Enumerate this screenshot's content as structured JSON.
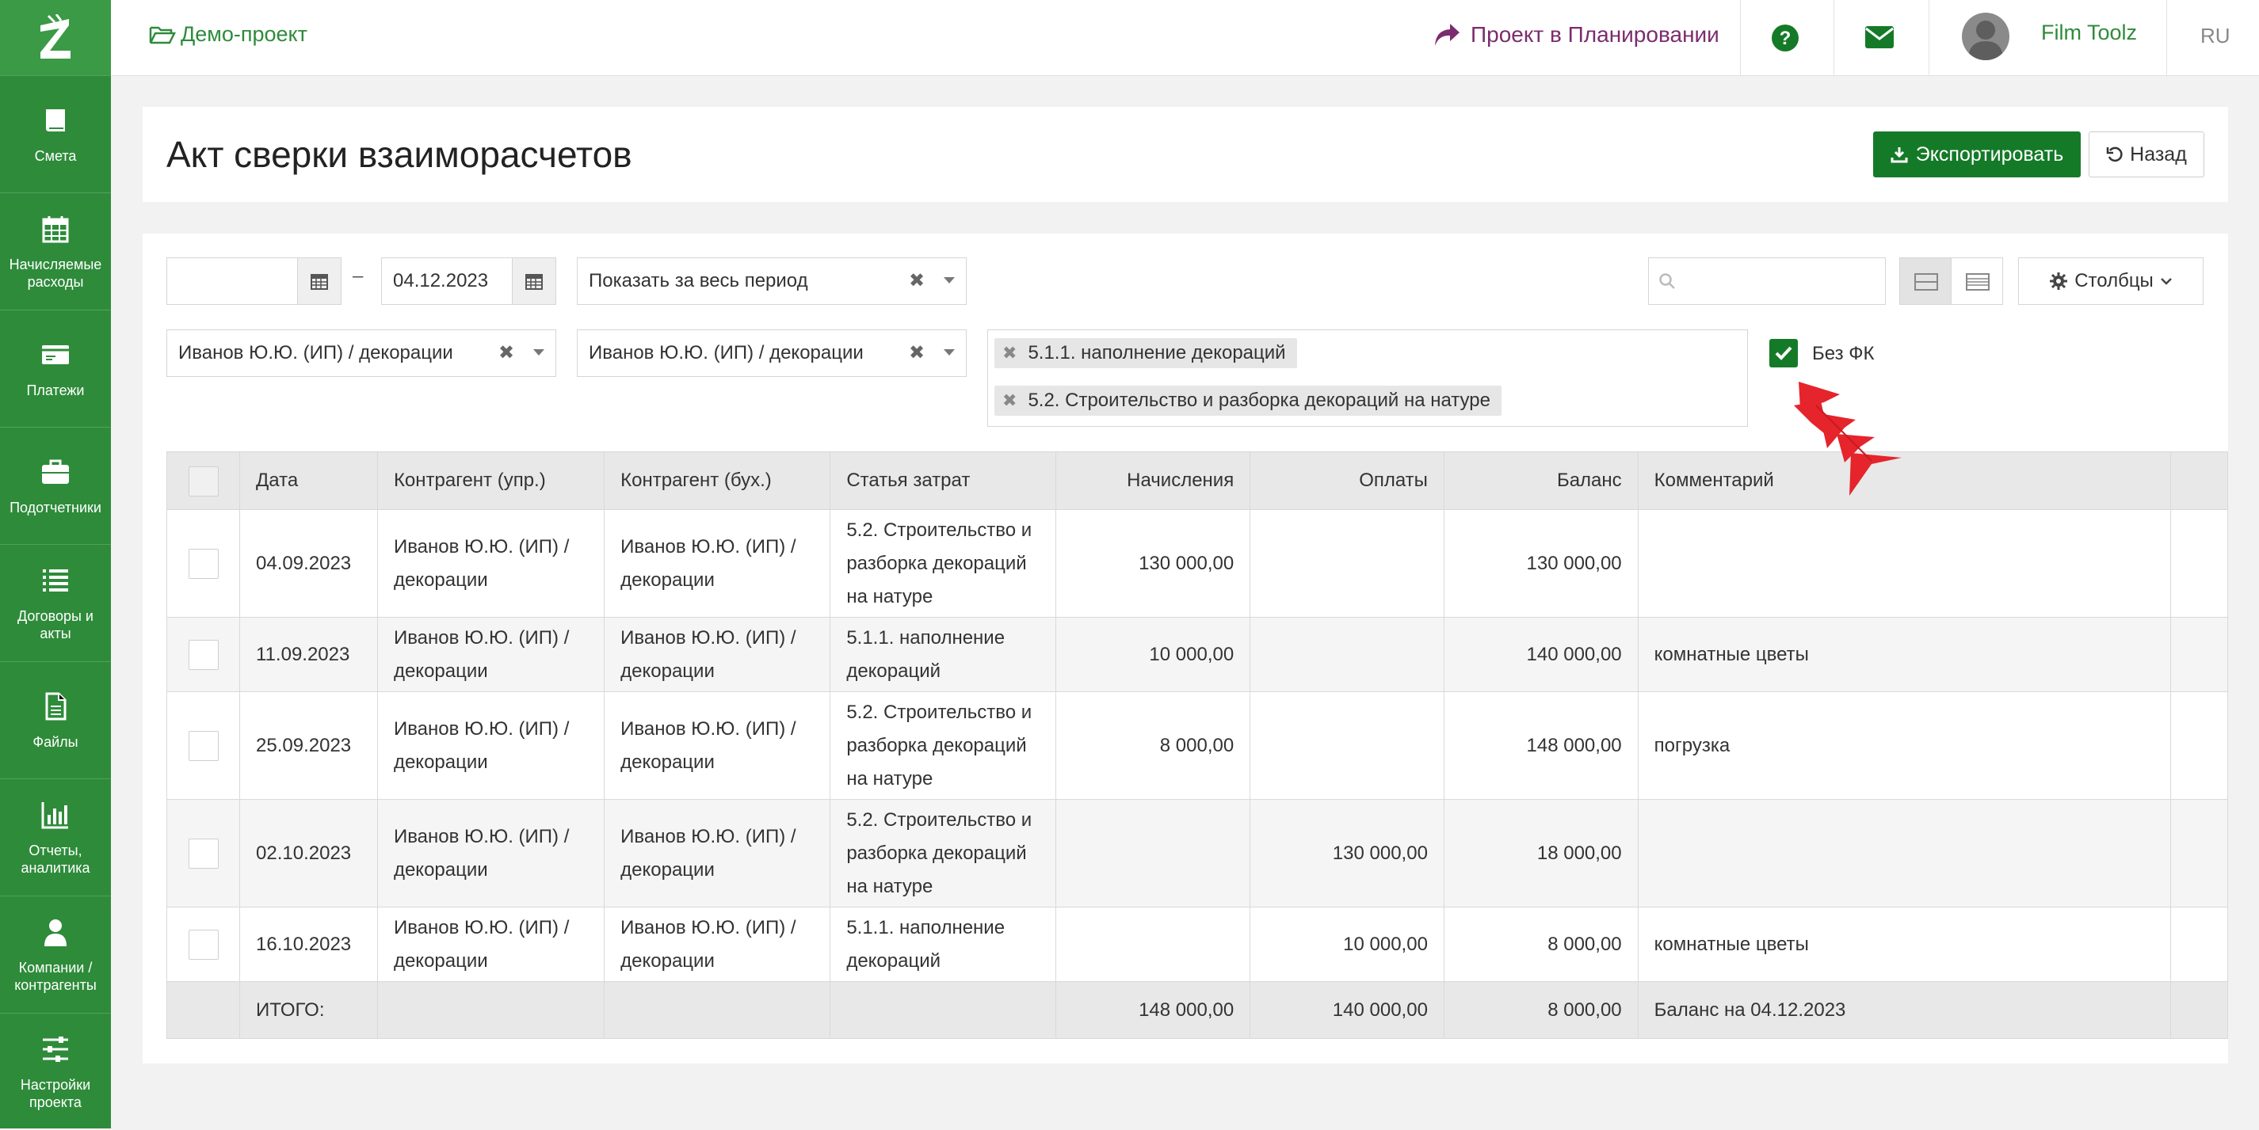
{
  "topbar": {
    "breadcrumb": "Демо-проект",
    "project_status": "Проект в Планировании",
    "user_name": "Film Toolz",
    "language": "RU"
  },
  "sidebar": {
    "items": [
      {
        "label": "Смета",
        "icon": "book-icon"
      },
      {
        "label": "Начисляемые расходы",
        "icon": "calendar-icon"
      },
      {
        "label": "Платежи",
        "icon": "credit-card-icon"
      },
      {
        "label": "Подотчетники",
        "icon": "briefcase-icon"
      },
      {
        "label": "Договоры и акты",
        "icon": "list-icon"
      },
      {
        "label": "Файлы",
        "icon": "file-icon"
      },
      {
        "label": "Отчеты, аналитика",
        "icon": "bar-chart-icon"
      },
      {
        "label": "Компании / контрагенты",
        "icon": "user-icon"
      },
      {
        "label": "Настройки проекта",
        "icon": "sliders-icon"
      }
    ]
  },
  "header": {
    "title": "Акт сверки взаиморасчетов",
    "export_label": "Экспортировать",
    "back_label": "Назад"
  },
  "filters": {
    "date_from": "",
    "date_to": "04.12.2023",
    "period": "Показать за весь период",
    "counterparty_mgmt": "Иванов Ю.Ю. (ИП) / декорации",
    "counterparty_acc": "Иванов Ю.Ю. (ИП) / декорации",
    "cost_items": [
      "5.1.1. наполнение декораций",
      "5.2. Строительство и разборка декораций на натуре"
    ],
    "search_value": "",
    "columns_label": "Столбцы",
    "no_fk_label": "Без ФК",
    "no_fk_checked": true
  },
  "table": {
    "headers": [
      "Дата",
      "Контрагент (упр.)",
      "Контрагент (бух.)",
      "Статья затрат",
      "Начисления",
      "Оплаты",
      "Баланс",
      "Комментарий"
    ],
    "rows": [
      {
        "date": "04.09.2023",
        "cp_mgmt": "Иванов Ю.Ю. (ИП) / декорации",
        "cp_acc": "Иванов Ю.Ю. (ИП) / декорации",
        "item": "5.2. Строительство и разборка декораций на натуре",
        "accrual": "130 000,00",
        "payment": "",
        "balance": "130 000,00",
        "comment": ""
      },
      {
        "date": "11.09.2023",
        "cp_mgmt": "Иванов Ю.Ю. (ИП) / декорации",
        "cp_acc": "Иванов Ю.Ю. (ИП) / декорации",
        "item": "5.1.1. наполнение декораций",
        "accrual": "10 000,00",
        "payment": "",
        "balance": "140 000,00",
        "comment": "комнатные цветы"
      },
      {
        "date": "25.09.2023",
        "cp_mgmt": "Иванов Ю.Ю. (ИП) / декорации",
        "cp_acc": "Иванов Ю.Ю. (ИП) / декорации",
        "item": "5.2. Строительство и разборка декораций на натуре",
        "accrual": "8 000,00",
        "payment": "",
        "balance": "148 000,00",
        "comment": "погрузка"
      },
      {
        "date": "02.10.2023",
        "cp_mgmt": "Иванов Ю.Ю. (ИП) / декорации",
        "cp_acc": "Иванов Ю.Ю. (ИП) / декорации",
        "item": "5.2. Строительство и разборка декораций на натуре",
        "accrual": "",
        "payment": "130 000,00",
        "balance": "18 000,00",
        "comment": ""
      },
      {
        "date": "16.10.2023",
        "cp_mgmt": "Иванов Ю.Ю. (ИП) / декорации",
        "cp_acc": "Иванов Ю.Ю. (ИП) / декорации",
        "item": "5.1.1. наполнение декораций",
        "accrual": "",
        "payment": "10 000,00",
        "balance": "8 000,00",
        "comment": "комнатные цветы"
      }
    ],
    "totals": {
      "label": "ИТОГО:",
      "accrual": "148 000,00",
      "payment": "140 000,00",
      "balance": "8 000,00",
      "comment": "Баланс на 04.12.2023"
    }
  },
  "colors": {
    "brand_green": "#2e8b3a",
    "button_green": "#157a28",
    "project_purple": "#7b2c6e",
    "annotation_red": "#e5242b"
  }
}
